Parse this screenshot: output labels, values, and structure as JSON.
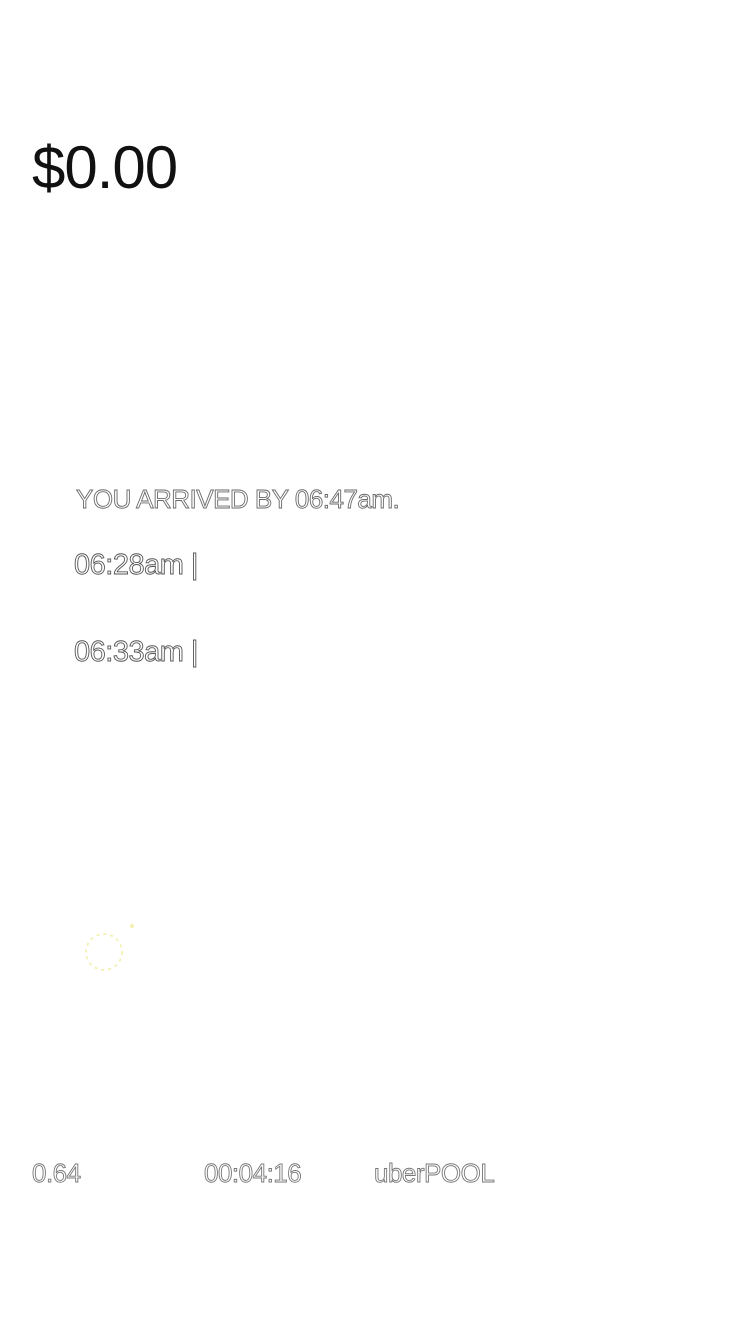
{
  "trip": {
    "fare": "$0.00",
    "arrival_text": "YOU ARRIVED BY 06:47am.",
    "timeline": [
      {
        "time": "06:28am |"
      },
      {
        "time": "06:33am |"
      }
    ],
    "stats": {
      "distance": "0.64",
      "duration": "00:04:16",
      "product": "uberPOOL"
    }
  },
  "icons": {
    "loading": "spinner-icon",
    "spinner_color": "#f3f0b0"
  }
}
